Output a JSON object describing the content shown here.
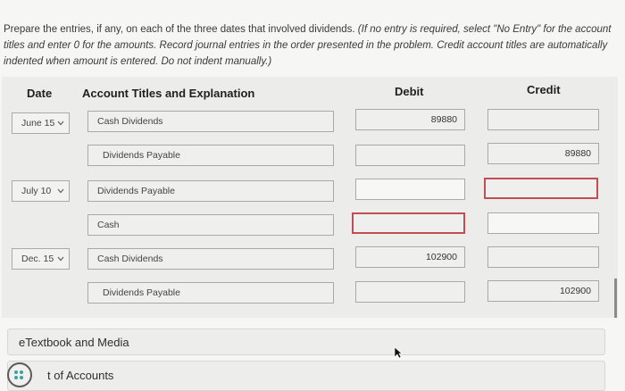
{
  "instructions": {
    "lead": "Prepare the entries, if any, on each of the three dates that involved dividends. ",
    "emphasis": "(If no entry is required, select \"No Entry\" for the account titles and enter 0 for the amounts. Record journal entries in the order presented in the problem. Credit account titles are automatically indented when amount is entered. Do not indent manually.)"
  },
  "headers": {
    "date": "Date",
    "account": "Account Titles and Explanation",
    "debit": "Debit",
    "credit": "Credit"
  },
  "entries": [
    {
      "date": "June 15",
      "rows": [
        {
          "account": "Cash Dividends",
          "debit": "89880",
          "credit": ""
        },
        {
          "account": "Dividends Payable",
          "debit": "",
          "credit": "89880"
        }
      ]
    },
    {
      "date": "July 10",
      "rows": [
        {
          "account": "Dividends Payable",
          "debit": "",
          "credit": ""
        },
        {
          "account": "Cash",
          "debit": "",
          "credit": ""
        }
      ]
    },
    {
      "date": "Dec. 15",
      "rows": [
        {
          "account": "Cash Dividends",
          "debit": "102900",
          "credit": ""
        },
        {
          "account": "Dividends Payable",
          "debit": "",
          "credit": "102900"
        }
      ]
    }
  ],
  "etextbook": {
    "label": "eTextbook and Media"
  },
  "accounts_link": {
    "label": "t of Accounts"
  },
  "colors": {
    "error_border": "#c24d55",
    "field_border": "#a9a9a7"
  }
}
